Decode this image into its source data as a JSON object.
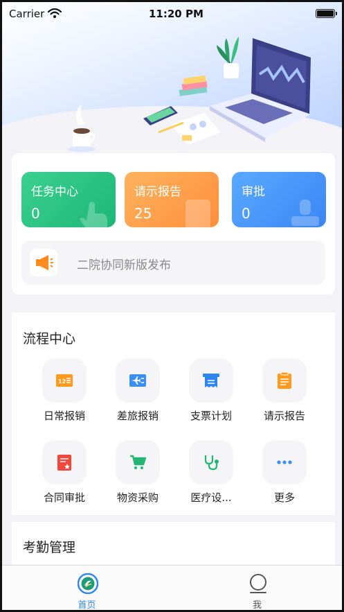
{
  "status_bar": {
    "carrier": "Carrier",
    "time": "11:20 PM"
  },
  "summary_tiles": [
    {
      "label": "任务中心",
      "count": "0",
      "color": "#2cc484"
    },
    {
      "label": "请示报告",
      "count": "25",
      "color": "#ff9e47"
    },
    {
      "label": "审批",
      "count": "0",
      "color": "#4a97fb"
    }
  ],
  "notice": {
    "text": "二院协同新版发布",
    "icon": "megaphone-icon"
  },
  "process_center": {
    "title": "流程中心",
    "items": [
      {
        "label": "日常报销",
        "icon": "daily-expense-icon",
        "color": "#ff9a1f"
      },
      {
        "label": "差旅报销",
        "icon": "travel-expense-icon",
        "color": "#3a8ff5"
      },
      {
        "label": "支票计划",
        "icon": "check-plan-icon",
        "color": "#2f86f0"
      },
      {
        "label": "请示报告",
        "icon": "report-icon",
        "color": "#ff9a1f"
      },
      {
        "label": "合同审批",
        "icon": "contract-icon",
        "color": "#f2473a"
      },
      {
        "label": "物资采购",
        "icon": "shopping-cart-icon",
        "color": "#22b573"
      },
      {
        "label": "医疗设...",
        "icon": "stethoscope-icon",
        "color": "#22b573"
      },
      {
        "label": "更多",
        "icon": "more-icon",
        "color": "#3a8ff5"
      }
    ]
  },
  "attendance": {
    "title": "考勤管理"
  },
  "tab_bar": {
    "tabs": [
      {
        "label": "首页",
        "icon": "home-logo-icon",
        "active": true,
        "color": "#2f86f0"
      },
      {
        "label": "我",
        "icon": "profile-icon",
        "active": false,
        "color": "#555555"
      }
    ]
  }
}
